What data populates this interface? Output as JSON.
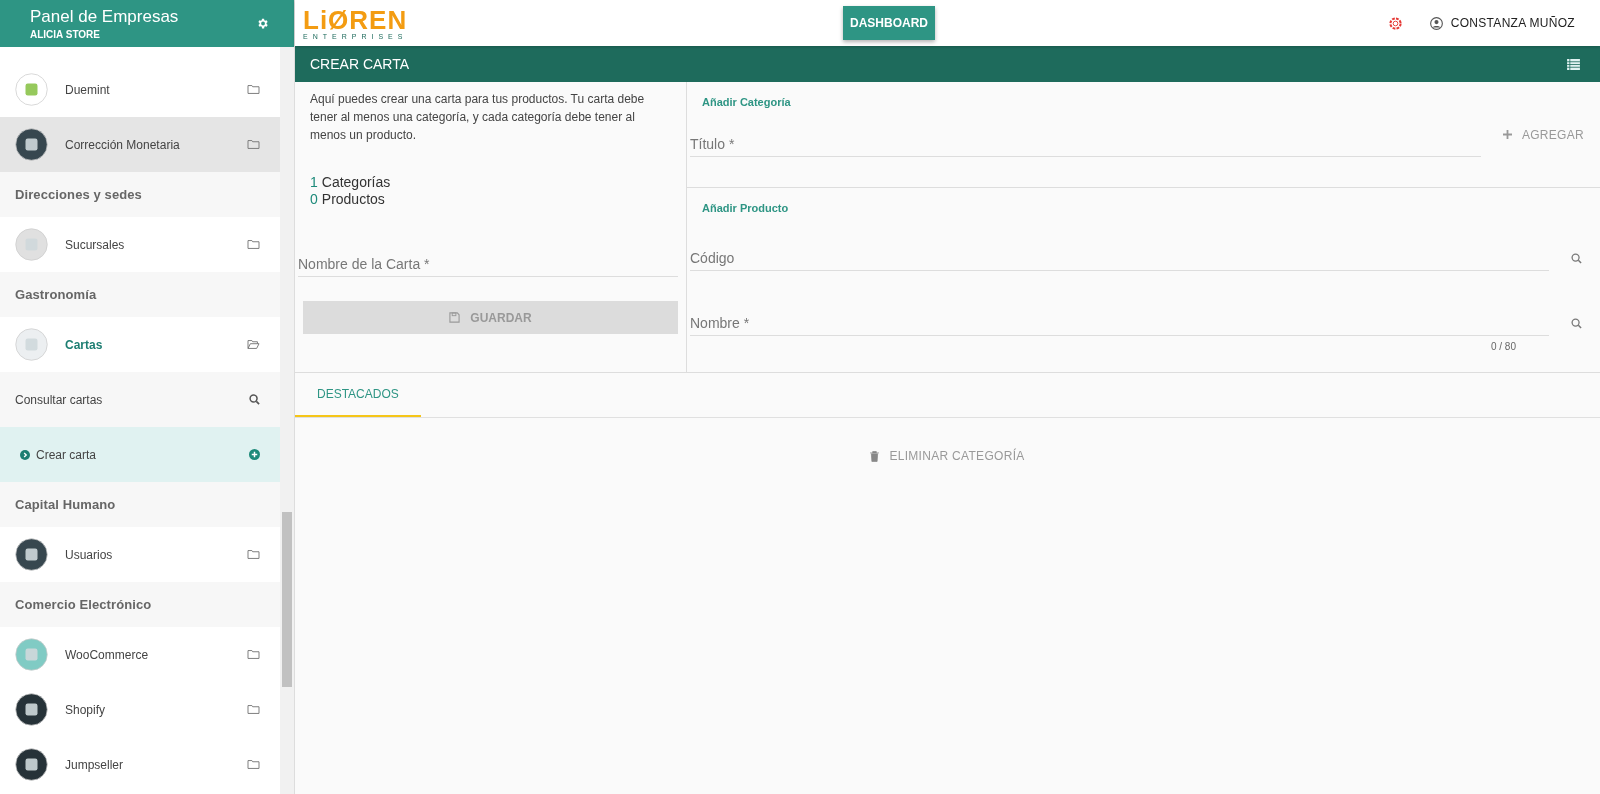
{
  "sidebar": {
    "title": "Panel de Empresas",
    "subtitle": "ALICIA STORE",
    "items": [
      {
        "kind": "app",
        "label": "Duemint",
        "highlighted": false,
        "expanded": false
      },
      {
        "kind": "app",
        "label": "Corrección Monetaria",
        "highlighted": true,
        "expanded": false
      },
      {
        "kind": "section",
        "label": "Direcciones y sedes"
      },
      {
        "kind": "app",
        "label": "Sucursales",
        "highlighted": false,
        "expanded": false
      },
      {
        "kind": "section",
        "label": "Gastronomía"
      },
      {
        "kind": "app",
        "label": "Cartas",
        "highlighted": false,
        "expanded": true
      },
      {
        "kind": "sub_search",
        "label": "Consultar cartas",
        "selected": false
      },
      {
        "kind": "sub_add",
        "label": "Crear carta",
        "selected": true
      },
      {
        "kind": "section",
        "label": "Capital Humano"
      },
      {
        "kind": "app",
        "label": "Usuarios",
        "highlighted": false,
        "expanded": false
      },
      {
        "kind": "section",
        "label": "Comercio Electrónico"
      },
      {
        "kind": "app",
        "label": "WooCommerce",
        "highlighted": false,
        "expanded": false
      },
      {
        "kind": "app",
        "label": "Shopify",
        "highlighted": false,
        "expanded": false
      },
      {
        "kind": "app",
        "label": "Jumpseller",
        "highlighted": false,
        "expanded": false
      }
    ]
  },
  "topbar": {
    "logo": "LiØREN",
    "logo_sub": "ENTERPRISES",
    "dashboard_button": "DASHBOARD",
    "user": "CONSTANZA MUÑOZ"
  },
  "page": {
    "title": "CREAR CARTA",
    "intro": "Aquí puedes crear una carta para tus productos. Tu carta debe tener al menos una categoría, y cada categoría debe tener al menos un producto.",
    "counts": [
      {
        "number": "1",
        "label": "Categorías"
      },
      {
        "number": "0",
        "label": "Productos"
      }
    ],
    "name_field": {
      "placeholder": "Nombre de la Carta *"
    },
    "save_button": {
      "label": "GUARDAR",
      "disabled": true
    },
    "category": {
      "heading": "Añadir Categoría",
      "title_field": {
        "placeholder": "Título *"
      },
      "add_button": "AGREGAR"
    },
    "product": {
      "heading": "Añadir Producto",
      "code_field": {
        "placeholder": "Código"
      },
      "name_field": {
        "placeholder": "Nombre *"
      },
      "counter": "0 / 80"
    },
    "tabs": [
      {
        "label": "DESTACADOS",
        "selected": true
      }
    ],
    "delete_button": "ELIMINAR CATEGORÍA"
  }
}
